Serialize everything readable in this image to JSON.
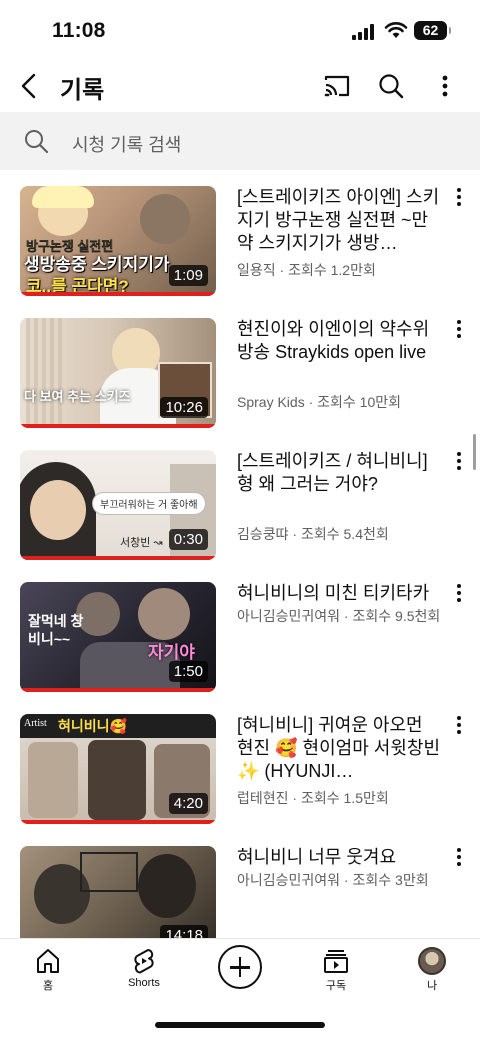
{
  "status": {
    "time": "11:08",
    "battery": "62"
  },
  "header": {
    "title": "기록"
  },
  "search": {
    "placeholder": "시청 기록 검색"
  },
  "videos": [
    {
      "title": "[스트레이키즈 아이엔] 스키지기 방구논쟁 실전편 ~만약 스키지기가 생방…",
      "channel": "일용직",
      "views": "조회수 1.2만회",
      "duration": "1:09",
      "thumb_caption_top": "방구논쟁 실전편",
      "thumb_caption_main": "생방송중 스키지기가",
      "thumb_caption_bottom": "코..를 곤다면?",
      "colors": [
        "#c9a98a",
        "#7a6a58"
      ]
    },
    {
      "title": "현진이와 이엔이의 약수위 방송 Straykids open live",
      "channel": "Spray Kids",
      "views": "조회수 10만회",
      "duration": "10:26",
      "thumb_caption_main": "다 보여 추는 스키즈",
      "colors": [
        "#e8ded2",
        "#b9a48f"
      ]
    },
    {
      "title": "[스트레이키즈 / 혀니비니] 형 왜 그러는 거야?",
      "channel": "김승쿵땨",
      "views": "조회수 5.4천회",
      "duration": "0:30",
      "thumb_caption_main": "부끄러워하는 거 좋아해",
      "thumb_caption_tag": "서창빈 ↝",
      "colors": [
        "#f1ede9",
        "#cfc5bc"
      ]
    },
    {
      "title": "혀니비니의 미친 티키타카",
      "channel": "아니김승민귀여워",
      "views": "조회수 9.5천회",
      "duration": "1:50",
      "thumb_caption_main": "잘먹네 창비니~~",
      "thumb_caption_tag": "자기야",
      "colors": [
        "#3a3848",
        "#1d1c26"
      ]
    },
    {
      "title": "[혀니비니] 귀여운 아오먼 현진 🥰 현이엄마 서윗창빈✨ (HYUNJI…",
      "channel": "럽테현진",
      "views": "조회수 1.5만회",
      "duration": "4:20",
      "thumb_caption_main": "혀니비니🥰",
      "thumb_caption_tag": "Artist",
      "colors": [
        "#2a2a2a",
        "#d9d0c5"
      ]
    },
    {
      "title": "혀니비니 너무 웃겨요",
      "channel": "아니김승민귀여워",
      "views": "조회수 3만회",
      "duration": "14:18",
      "colors": [
        "#8a7c6a",
        "#3b342b"
      ]
    }
  ],
  "nav": {
    "home": "홈",
    "shorts": "Shorts",
    "subscriptions": "구독",
    "you": "나"
  },
  "icons": {
    "back": "chevron-left-icon",
    "cast": "cast-icon",
    "search": "search-icon",
    "more": "more-vertical-icon"
  }
}
